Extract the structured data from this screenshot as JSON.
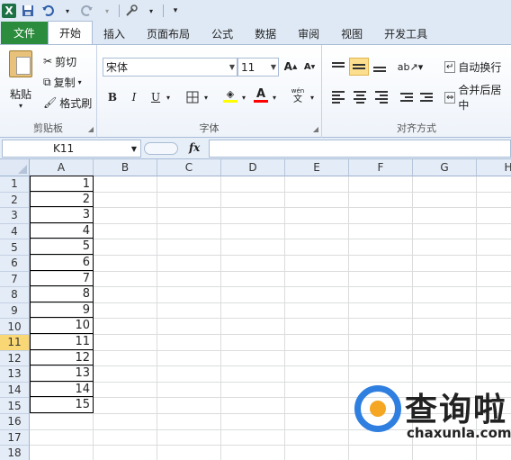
{
  "quick_access": {
    "logo": "X",
    "icons": [
      "excel-logo-icon",
      "save-icon",
      "undo-icon",
      "redo-icon",
      "customize-icon"
    ]
  },
  "tabs": [
    "文件",
    "开始",
    "插入",
    "页面布局",
    "公式",
    "数据",
    "审阅",
    "视图",
    "开发工具"
  ],
  "ribbon": {
    "clipboard": {
      "paste": "粘贴",
      "cut": "剪切",
      "copy": "复制",
      "format_painter": "格式刷",
      "label": "剪贴板"
    },
    "font": {
      "family": "宋体",
      "size": "11",
      "bold": "B",
      "italic": "I",
      "underline": "U",
      "label": "字体",
      "fill_color": "#ffff00",
      "font_color": "#ff0000"
    },
    "alignment": {
      "wrap_text": "自动换行",
      "merge_center": "合并后居中",
      "label": "对齐方式"
    }
  },
  "formula_bar": {
    "name_box": "K11",
    "fx": "fx",
    "formula": ""
  },
  "sheet": {
    "columns": [
      "A",
      "B",
      "C",
      "D",
      "E",
      "F",
      "G",
      "H"
    ],
    "rows": [
      "1",
      "2",
      "3",
      "4",
      "5",
      "6",
      "7",
      "8",
      "9",
      "10",
      "11",
      "12",
      "13",
      "14",
      "15",
      "16",
      "17",
      "18"
    ],
    "selected_row": "11",
    "column_a_values": [
      "1",
      "2",
      "3",
      "4",
      "5",
      "6",
      "7",
      "8",
      "9",
      "10",
      "11",
      "12",
      "13",
      "14",
      "15"
    ]
  },
  "watermark": {
    "title": "查询啦",
    "url": "chaxunla.com"
  }
}
